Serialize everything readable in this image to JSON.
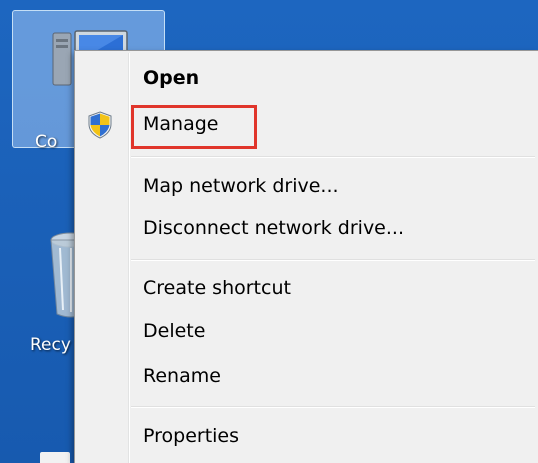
{
  "desktop": {
    "computer_label": "Co",
    "recycle_label": "Recy"
  },
  "menu": {
    "items": [
      {
        "label": "Open"
      },
      {
        "label": "Manage"
      },
      {
        "label": "Map network drive..."
      },
      {
        "label": "Disconnect network drive..."
      },
      {
        "label": "Create shortcut"
      },
      {
        "label": "Delete"
      },
      {
        "label": "Rename"
      },
      {
        "label": "Properties"
      }
    ],
    "manage_icon": "uac-shield-icon"
  },
  "annotation": {
    "highlight_color": "#e0352b",
    "highlighted_item": "Manage"
  }
}
